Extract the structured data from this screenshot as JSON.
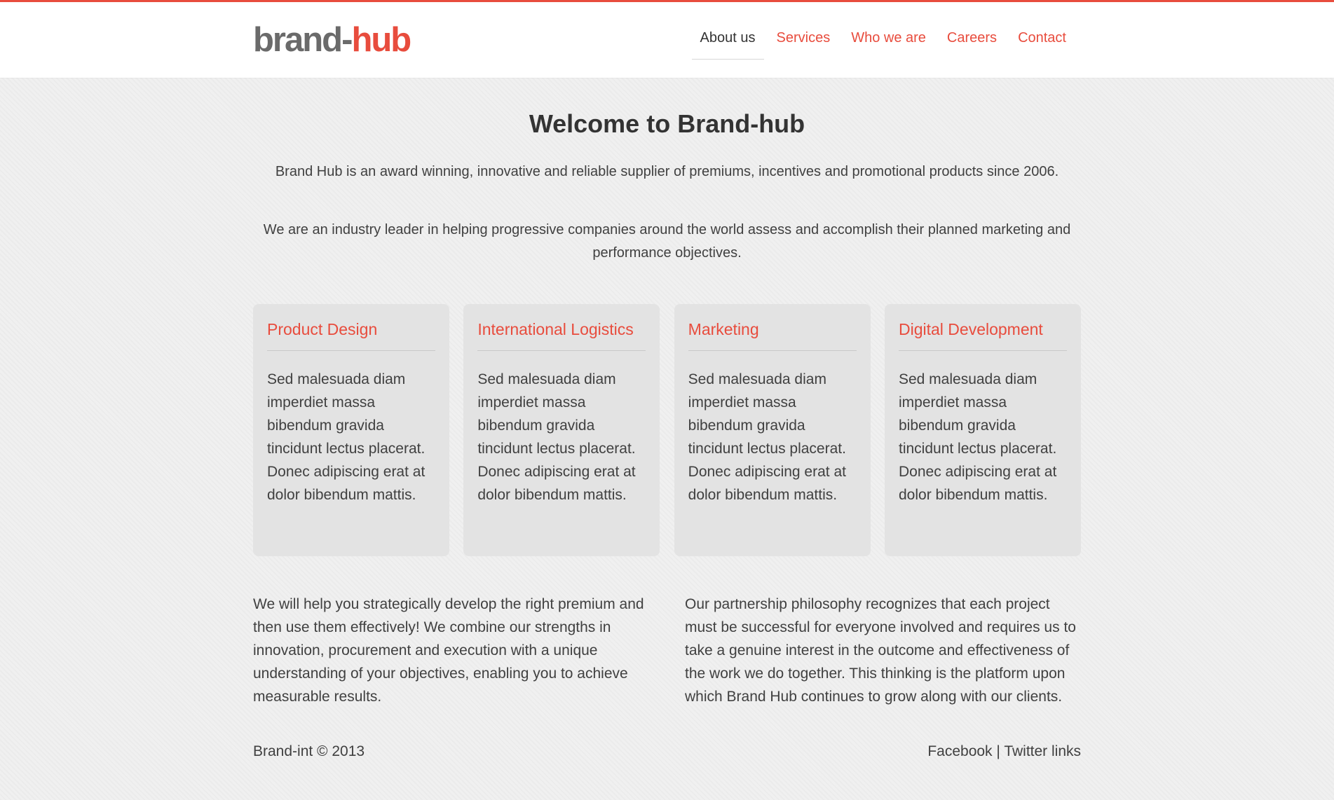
{
  "brand": {
    "logo_part1": "brand-",
    "logo_part2": "hub"
  },
  "nav": {
    "items": [
      {
        "label": "About us",
        "active": true
      },
      {
        "label": "Services",
        "active": false
      },
      {
        "label": "Who we are",
        "active": false
      },
      {
        "label": "Careers",
        "active": false
      },
      {
        "label": "Contact",
        "active": false
      }
    ]
  },
  "intro": {
    "title": "Welcome to Brand-hub",
    "paragraph1": "Brand Hub is an award winning, innovative and reliable supplier of premiums, incentives and promotional products since 2006.",
    "paragraph2": "We are an industry leader in helping progressive companies around the world assess and accomplish their planned marketing and performance objectives."
  },
  "cards": [
    {
      "title": "Product Design",
      "body": "Sed malesuada diam imperdiet massa bibendum gravida tincidunt lectus placerat. Donec adipiscing erat at dolor bibendum mattis."
    },
    {
      "title": "International Logistics",
      "body": "Sed malesuada diam imperdiet massa bibendum gravida tincidunt lectus placerat. Donec adipiscing erat at dolor bibendum mattis."
    },
    {
      "title": "Marketing",
      "body": "Sed malesuada diam imperdiet massa bibendum gravida tincidunt lectus placerat. Donec adipiscing erat at dolor bibendum mattis."
    },
    {
      "title": "Digital Development",
      "body": "Sed malesuada diam imperdiet massa bibendum gravida tincidunt lectus placerat. Donec adipiscing erat at dolor bibendum mattis."
    }
  ],
  "columns": {
    "left": "We will help you strategically develop the right premium and then use them effectively! We combine our strengths in innovation, procurement and execution with a unique understanding of your objectives, enabling you to achieve measurable results.",
    "right": "Our partnership philosophy recognizes that each project must be successful for everyone involved and requires us to take a genuine interest in the outcome and effectiveness of the work we do together. This thinking is the platform upon which Brand Hub continues to grow along with our clients."
  },
  "footer": {
    "copyright": "Brand-int © 2013",
    "facebook": "Facebook",
    "separator": " | ",
    "twitter": "Twitter links"
  },
  "colors": {
    "accent": "#e84c3d",
    "logo_gray": "#6a6a6a",
    "text": "#333333",
    "card_bg": "#e3e3e3",
    "page_bg": "#f0f0f0"
  }
}
